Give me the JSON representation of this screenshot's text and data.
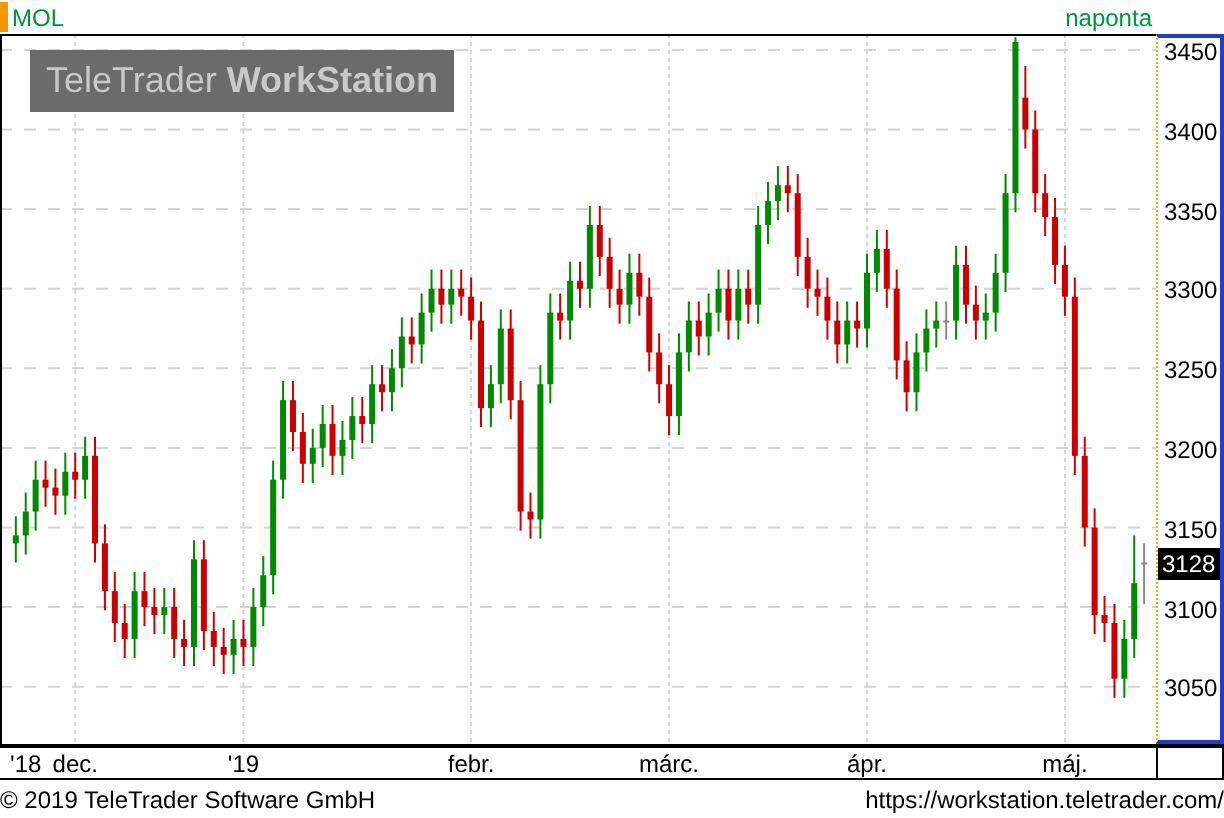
{
  "header": {
    "symbol": "MOL",
    "interval": "naponta"
  },
  "logo": {
    "text": "TeleTrader **WorkStation**"
  },
  "chart": {
    "last_price": "3128",
    "chart_data": {
      "type": "candlestick",
      "ylim": [
        3014,
        3460
      ],
      "grid": true,
      "yticks": [
        3050,
        3100,
        3150,
        3200,
        3250,
        3300,
        3350,
        3400,
        3450
      ],
      "categories": [
        null,
        "'18",
        null,
        null,
        null,
        null,
        "dec.",
        null,
        null,
        null,
        null,
        null,
        null,
        null,
        null,
        null,
        null,
        null,
        null,
        null,
        null,
        null,
        null,
        "'19",
        null,
        null,
        null,
        null,
        null,
        null,
        null,
        null,
        null,
        null,
        null,
        null,
        null,
        null,
        null,
        null,
        null,
        null,
        null,
        null,
        null,
        null,
        "febr.",
        null,
        null,
        null,
        null,
        null,
        null,
        null,
        null,
        null,
        null,
        null,
        null,
        null,
        null,
        null,
        null,
        null,
        null,
        null,
        "márc.",
        null,
        null,
        null,
        null,
        null,
        null,
        null,
        null,
        null,
        null,
        null,
        null,
        null,
        null,
        null,
        null,
        null,
        null,
        null,
        "ápr.",
        null,
        null,
        null,
        null,
        null,
        null,
        null,
        null,
        null,
        null,
        null,
        null,
        null,
        null,
        null,
        null,
        null,
        null,
        null,
        "máj.",
        null,
        null,
        null,
        null,
        null,
        null,
        null,
        null
      ],
      "ohlc": [
        [
          3140,
          3157,
          3128,
          3145
        ],
        [
          3145,
          3172,
          3133,
          3160
        ],
        [
          3160,
          3192,
          3148,
          3180
        ],
        [
          3180,
          3192,
          3163,
          3175
        ],
        [
          3175,
          3187,
          3158,
          3170
        ],
        [
          3170,
          3197,
          3158,
          3185
        ],
        [
          3185,
          3197,
          3168,
          3180
        ],
        [
          3180,
          3207,
          3168,
          3195
        ],
        [
          3195,
          3207,
          3128,
          3140
        ],
        [
          3140,
          3152,
          3098,
          3110
        ],
        [
          3110,
          3122,
          3078,
          3090
        ],
        [
          3090,
          3102,
          3068,
          3080
        ],
        [
          3080,
          3122,
          3068,
          3110
        ],
        [
          3110,
          3122,
          3088,
          3100
        ],
        [
          3100,
          3112,
          3083,
          3095
        ],
        [
          3095,
          3112,
          3083,
          3100
        ],
        [
          3100,
          3112,
          3068,
          3080
        ],
        [
          3080,
          3092,
          3063,
          3075
        ],
        [
          3075,
          3142,
          3063,
          3130
        ],
        [
          3130,
          3142,
          3073,
          3085
        ],
        [
          3085,
          3097,
          3063,
          3075
        ],
        [
          3075,
          3087,
          3058,
          3070
        ],
        [
          3070,
          3092,
          3058,
          3080
        ],
        [
          3080,
          3092,
          3063,
          3075
        ],
        [
          3075,
          3112,
          3063,
          3100
        ],
        [
          3100,
          3132,
          3088,
          3120
        ],
        [
          3120,
          3192,
          3108,
          3180
        ],
        [
          3180,
          3242,
          3168,
          3230
        ],
        [
          3230,
          3242,
          3198,
          3210
        ],
        [
          3210,
          3222,
          3178,
          3190
        ],
        [
          3190,
          3212,
          3178,
          3200
        ],
        [
          3200,
          3227,
          3188,
          3215
        ],
        [
          3215,
          3227,
          3183,
          3195
        ],
        [
          3195,
          3217,
          3183,
          3205
        ],
        [
          3205,
          3232,
          3193,
          3220
        ],
        [
          3220,
          3232,
          3203,
          3215
        ],
        [
          3215,
          3252,
          3203,
          3240
        ],
        [
          3240,
          3252,
          3223,
          3235
        ],
        [
          3235,
          3262,
          3223,
          3250
        ],
        [
          3250,
          3282,
          3238,
          3270
        ],
        [
          3270,
          3282,
          3253,
          3265
        ],
        [
          3265,
          3297,
          3253,
          3285
        ],
        [
          3285,
          3312,
          3273,
          3300
        ],
        [
          3300,
          3312,
          3278,
          3290
        ],
        [
          3290,
          3312,
          3278,
          3300
        ],
        [
          3300,
          3312,
          3283,
          3295
        ],
        [
          3295,
          3307,
          3268,
          3280
        ],
        [
          3280,
          3292,
          3213,
          3225
        ],
        [
          3225,
          3252,
          3213,
          3240
        ],
        [
          3240,
          3287,
          3228,
          3275
        ],
        [
          3275,
          3287,
          3218,
          3230
        ],
        [
          3230,
          3242,
          3148,
          3160
        ],
        [
          3160,
          3172,
          3143,
          3155
        ],
        [
          3155,
          3252,
          3143,
          3240
        ],
        [
          3240,
          3297,
          3228,
          3285
        ],
        [
          3285,
          3297,
          3268,
          3280
        ],
        [
          3280,
          3317,
          3268,
          3305
        ],
        [
          3305,
          3317,
          3288,
          3300
        ],
        [
          3300,
          3352,
          3288,
          3340
        ],
        [
          3340,
          3352,
          3308,
          3320
        ],
        [
          3320,
          3332,
          3288,
          3300
        ],
        [
          3300,
          3312,
          3278,
          3290
        ],
        [
          3290,
          3322,
          3278,
          3310
        ],
        [
          3310,
          3322,
          3283,
          3295
        ],
        [
          3295,
          3307,
          3248,
          3260
        ],
        [
          3260,
          3272,
          3228,
          3240
        ],
        [
          3240,
          3252,
          3208,
          3220
        ],
        [
          3220,
          3272,
          3208,
          3260
        ],
        [
          3260,
          3292,
          3248,
          3280
        ],
        [
          3280,
          3292,
          3258,
          3270
        ],
        [
          3270,
          3297,
          3258,
          3285
        ],
        [
          3285,
          3312,
          3273,
          3300
        ],
        [
          3300,
          3312,
          3268,
          3280
        ],
        [
          3280,
          3312,
          3268,
          3300
        ],
        [
          3300,
          3312,
          3278,
          3290
        ],
        [
          3290,
          3352,
          3278,
          3340
        ],
        [
          3340,
          3367,
          3328,
          3355
        ],
        [
          3355,
          3377,
          3343,
          3365
        ],
        [
          3365,
          3377,
          3348,
          3360
        ],
        [
          3360,
          3372,
          3308,
          3320
        ],
        [
          3320,
          3332,
          3288,
          3300
        ],
        [
          3300,
          3312,
          3283,
          3295
        ],
        [
          3295,
          3307,
          3268,
          3280
        ],
        [
          3280,
          3292,
          3253,
          3265
        ],
        [
          3265,
          3292,
          3253,
          3280
        ],
        [
          3280,
          3292,
          3263,
          3275
        ],
        [
          3275,
          3322,
          3263,
          3310
        ],
        [
          3310,
          3337,
          3298,
          3325
        ],
        [
          3325,
          3337,
          3288,
          3300
        ],
        [
          3300,
          3312,
          3243,
          3255
        ],
        [
          3255,
          3267,
          3223,
          3235
        ],
        [
          3235,
          3272,
          3223,
          3260
        ],
        [
          3260,
          3287,
          3248,
          3275
        ],
        [
          3275,
          3292,
          3263,
          3280
        ],
        [
          3280,
          3292,
          3268,
          3280
        ],
        [
          3280,
          3327,
          3268,
          3315
        ],
        [
          3315,
          3327,
          3278,
          3290
        ],
        [
          3290,
          3302,
          3268,
          3280
        ],
        [
          3280,
          3297,
          3268,
          3285
        ],
        [
          3285,
          3322,
          3273,
          3310
        ],
        [
          3310,
          3372,
          3298,
          3360
        ],
        [
          3360,
          3458,
          3348,
          3455
        ],
        [
          3420,
          3440,
          3388,
          3400
        ],
        [
          3400,
          3412,
          3348,
          3360
        ],
        [
          3360,
          3372,
          3333,
          3345
        ],
        [
          3345,
          3357,
          3303,
          3315
        ],
        [
          3315,
          3327,
          3283,
          3295
        ],
        [
          3295,
          3307,
          3183,
          3195
        ],
        [
          3195,
          3207,
          3138,
          3150
        ],
        [
          3150,
          3162,
          3083,
          3095
        ],
        [
          3095,
          3107,
          3078,
          3090
        ],
        [
          3090,
          3102,
          3043,
          3055
        ],
        [
          3055,
          3092,
          3043,
          3080
        ],
        [
          3080,
          3145,
          3068,
          3115
        ],
        [
          3128,
          3140,
          3102,
          3128
        ]
      ]
    }
  },
  "footer": {
    "copyright": "© 2019 TeleTrader Software GmbH",
    "url": "https://workstation.teletrader.com/"
  }
}
